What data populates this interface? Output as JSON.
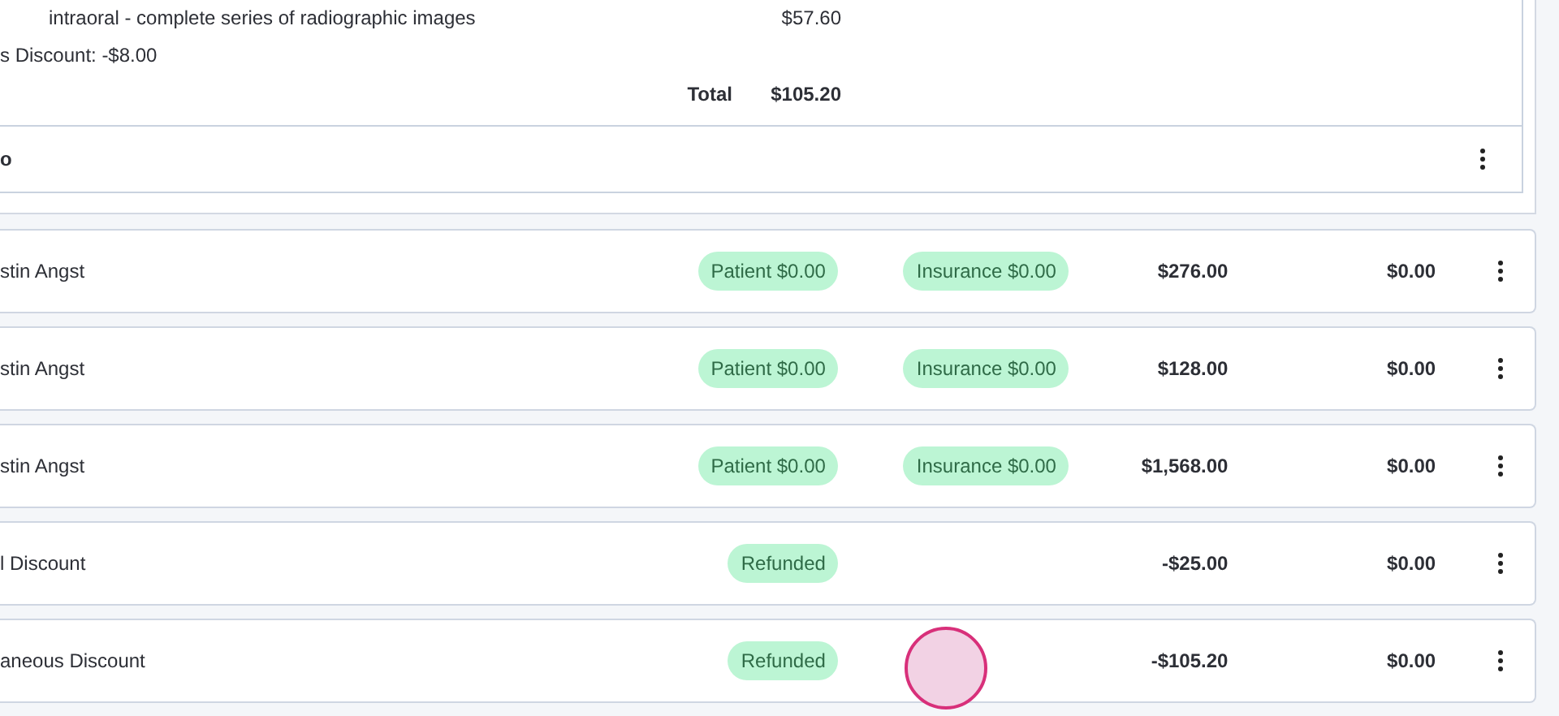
{
  "invoice_detail": {
    "line_items": [
      {
        "description": "intraoral - complete series of radiographic images",
        "amount": "$57.60"
      }
    ],
    "discount_text": "s Discount: -$8.00",
    "total_label": "Total",
    "total_amount": "$105.20",
    "footer_label": "o"
  },
  "transactions": [
    {
      "name": "stin Angst",
      "tags": [
        "Patient $0.00",
        "Insurance $0.00"
      ],
      "amount": "$276.00",
      "balance": "$0.00"
    },
    {
      "name": "stin Angst",
      "tags": [
        "Patient $0.00",
        "Insurance $0.00"
      ],
      "amount": "$128.00",
      "balance": "$0.00"
    },
    {
      "name": "stin Angst",
      "tags": [
        "Patient $0.00",
        "Insurance $0.00"
      ],
      "amount": "$1,568.00",
      "balance": "$0.00"
    },
    {
      "name": "l Discount",
      "tags": [
        "Refunded"
      ],
      "amount": "-$25.00",
      "balance": "$0.00"
    },
    {
      "name": "aneous Discount",
      "tags": [
        "Refunded"
      ],
      "amount": "-$105.20",
      "balance": "$0.00"
    }
  ]
}
